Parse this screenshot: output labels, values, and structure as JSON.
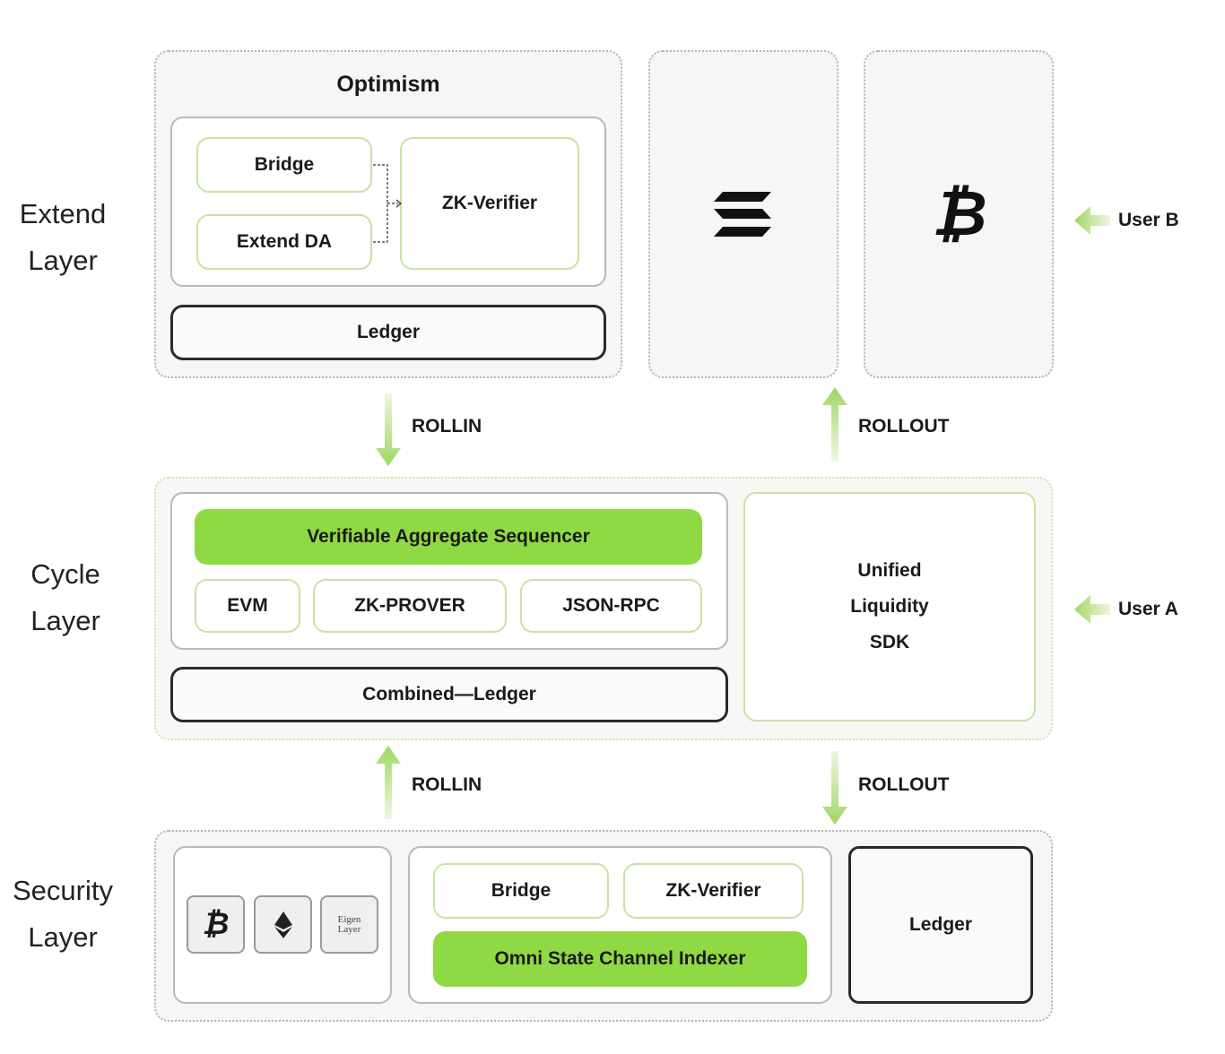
{
  "colors": {
    "accent_green": "#8fd944",
    "green_border": "#c8e3a2",
    "dark_border": "#2a2a2a"
  },
  "layers": {
    "extend": {
      "line1": "Extend",
      "line2": "Layer"
    },
    "cycle": {
      "line1": "Cycle",
      "line2": "Layer"
    },
    "security": {
      "line1": "Security",
      "line2": "Layer"
    }
  },
  "extend": {
    "optimism_title": "Optimism",
    "bridge": "Bridge",
    "extend_da": "Extend DA",
    "zk_verifier": "ZK-Verifier",
    "ledger": "Ledger",
    "chain_icons": [
      "solana-icon",
      "bitcoin-icon"
    ],
    "user_b": "User B"
  },
  "arrows": {
    "rollin_top": "ROLLIN",
    "rollout_top": "ROLLOUT",
    "rollin_bottom": "ROLLIN",
    "rollout_bottom": "ROLLOUT"
  },
  "cycle": {
    "sequencer": "Verifiable Aggregate Sequencer",
    "modules": [
      "EVM",
      "ZK-PROVER",
      "JSON-RPC"
    ],
    "combined_ledger": "Combined—Ledger",
    "sdk": [
      "Unified",
      "Liquidity",
      "SDK"
    ],
    "user_a": "User A"
  },
  "security": {
    "chain_icons": [
      "bitcoin-icon",
      "ethereum-icon",
      "eigenlayer-logo"
    ],
    "logo_text": "EigenLayer",
    "bridge": "Bridge",
    "zk_verifier": "ZK-Verifier",
    "indexer": "Omni State Channel Indexer",
    "ledger": "Ledger"
  }
}
